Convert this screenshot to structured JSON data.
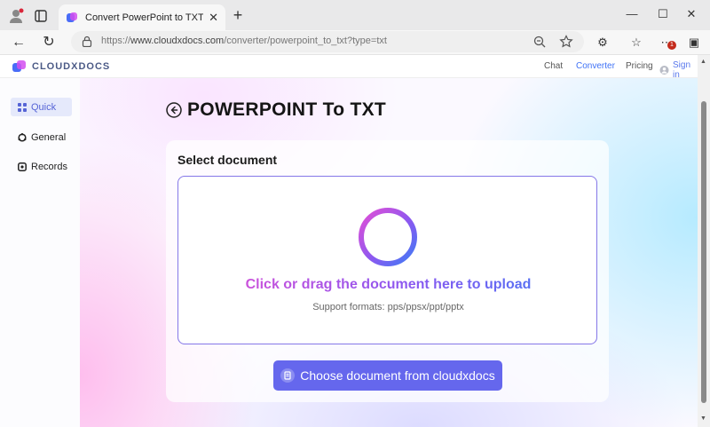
{
  "browser": {
    "tab_title": "Convert PowerPoint to TXT Fre Onli",
    "tab_close": "✕",
    "new_tab": "+",
    "url": {
      "prefix": "https://",
      "host": "www.cloudxdocs.com",
      "path": "/converter/powerpoint_to_txt?type=txt"
    },
    "window_controls": {
      "minimize": "—",
      "maximize": "☐",
      "close": "✕"
    },
    "notification_badge": "1"
  },
  "site": {
    "logo": "CLOUDXDOCS",
    "nav": [
      "Chat",
      "Converter",
      "Pricing"
    ],
    "active_nav": "Converter",
    "signin": "Sign in",
    "accent": "#3f72f6"
  },
  "sidebar": {
    "items": [
      {
        "label": "Quick",
        "icon": "grid-icon",
        "active": true
      },
      {
        "label": "General",
        "icon": "ring-icon",
        "active": false
      },
      {
        "label": "Records",
        "icon": "record-icon",
        "active": false
      }
    ]
  },
  "main": {
    "title": "POWERPOINT To TXT",
    "select_label": "Select document",
    "drop_text": "Click or drag the document here to upload",
    "formats_text": "Support formats: pps/ppsx/ppt/pptx",
    "choose_button": "Choose document from cloudxdocs",
    "button_color": "#6567ed",
    "drop_border_color": "#8577e8"
  }
}
